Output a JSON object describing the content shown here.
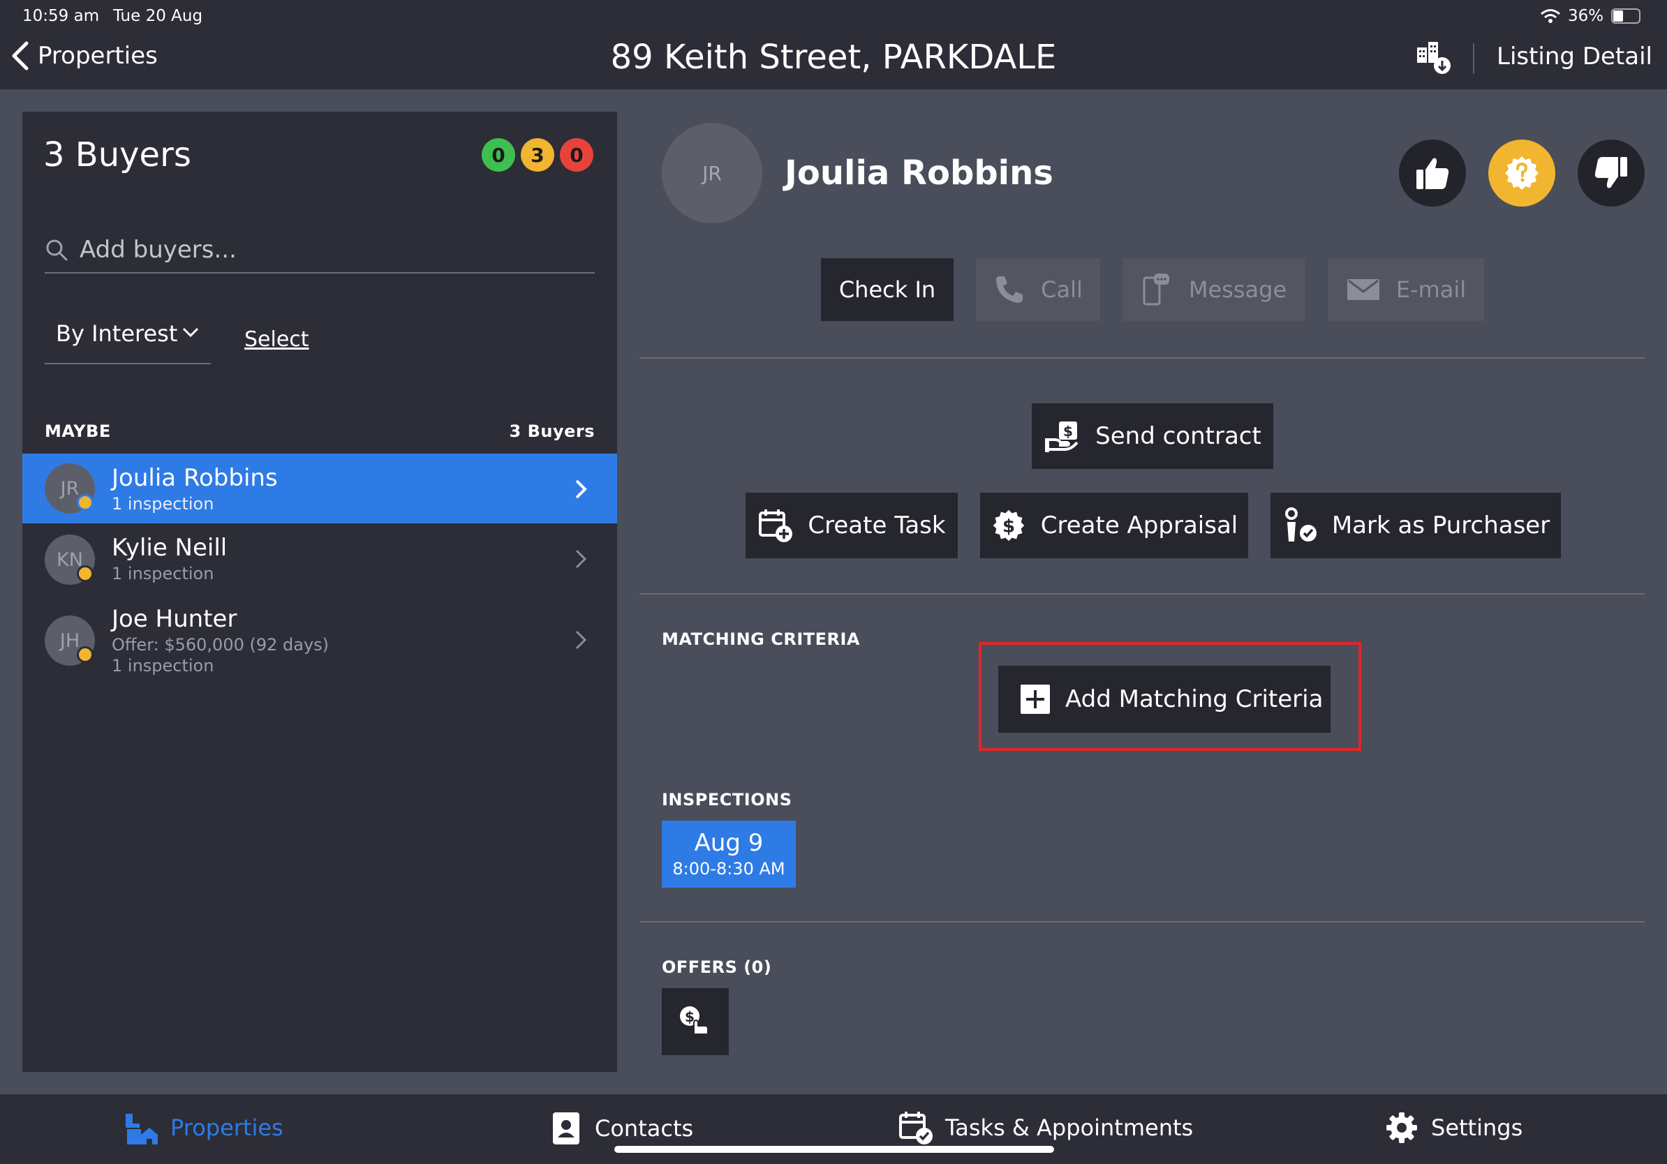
{
  "status_bar": {
    "time": "10:59 am",
    "date": "Tue 20 Aug",
    "battery": "36%"
  },
  "header": {
    "back_label": "Properties",
    "title": "89 Keith Street, PARKDALE",
    "listing_detail": "Listing Detail"
  },
  "left_panel": {
    "title": "3 Buyers",
    "badges": [
      {
        "value": "0",
        "color": "#3fbf4f"
      },
      {
        "value": "3",
        "color": "#f1b52f"
      },
      {
        "value": "0",
        "color": "#e8433a"
      }
    ],
    "search_placeholder": "Add buyers...",
    "sort_label": "By Interest",
    "select_label": "Select",
    "group_label": "MAYBE",
    "group_count": "3 Buyers",
    "buyers": [
      {
        "initials": "JR",
        "name": "Joulia Robbins",
        "line1": "1 inspection",
        "line2": ""
      },
      {
        "initials": "KN",
        "name": "Kylie Neill",
        "line1": "1 inspection",
        "line2": ""
      },
      {
        "initials": "JH",
        "name": "Joe Hunter",
        "line1": "Offer: $560,000 (92 days)",
        "line2": "1 inspection"
      }
    ]
  },
  "detail": {
    "initials": "JR",
    "name": "Joulia Robbins",
    "actions": {
      "check_in": "Check In",
      "call": "Call",
      "message": "Message",
      "email": "E-mail"
    },
    "send_contract": "Send contract",
    "create_task": "Create Task",
    "create_appraisal": "Create Appraisal",
    "mark_purchaser": "Mark as Purchaser",
    "matching_label": "MATCHING CRITERIA",
    "add_matching": "Add Matching Criteria",
    "inspections_label": "INSPECTIONS",
    "inspection": {
      "date": "Aug 9",
      "time": "8:00-8:30 AM"
    },
    "offers_label": "OFFERS (0)"
  },
  "tab_bar": {
    "properties": "Properties",
    "contacts": "Contacts",
    "tasks": "Tasks & Appointments",
    "settings": "Settings"
  },
  "colors": {
    "accent": "#2f7be6",
    "maybe": "#f1b52f",
    "highlight": "#e0262a"
  }
}
